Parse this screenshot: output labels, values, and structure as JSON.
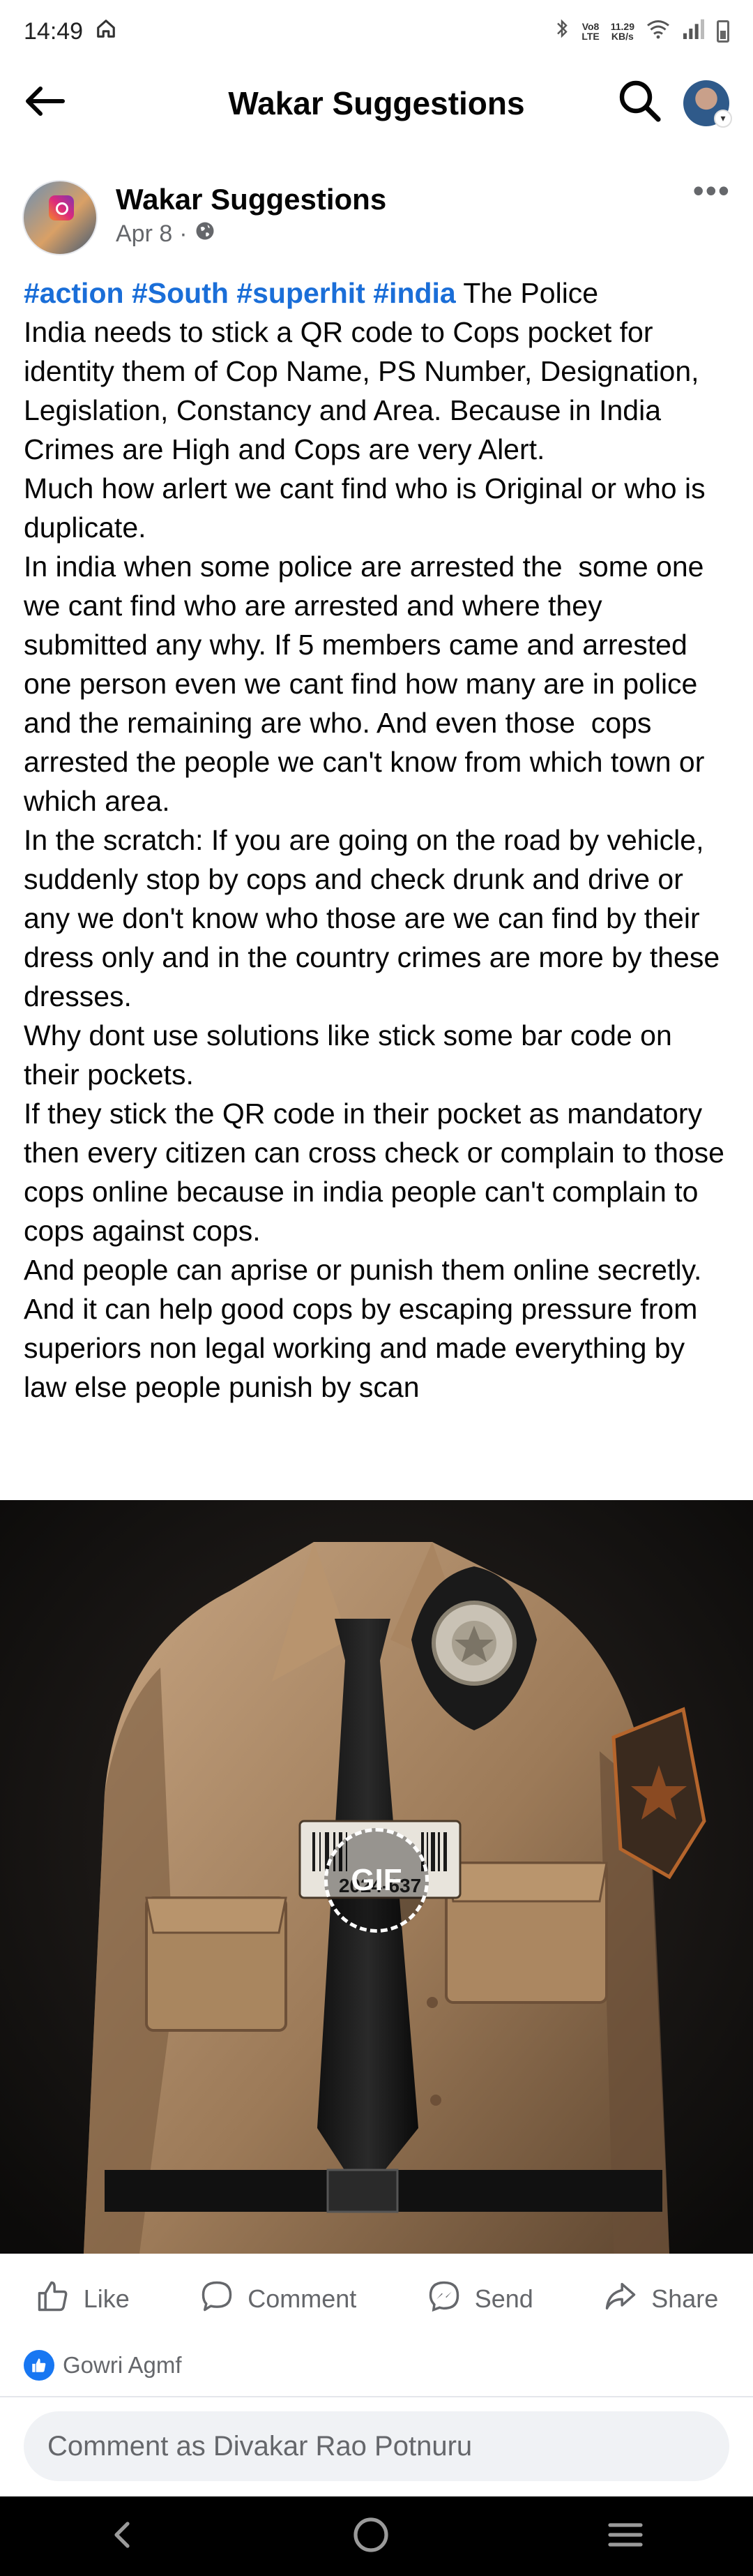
{
  "status_bar": {
    "time": "14:49",
    "network_volte": "Vo8",
    "network_lte": "LTE",
    "data_speed_value": "11.29",
    "data_speed_unit": "KB/s"
  },
  "header": {
    "title": "Wakar Suggestions"
  },
  "post": {
    "page_name": "Wakar Suggestions",
    "date": "Apr 8",
    "separator": "·",
    "hashtags": [
      "#action",
      "#South",
      "#superhit",
      "#india"
    ],
    "intro": "The Police",
    "paragraphs": [
      "India needs to stick a QR code to Cops pocket for identity them of Cop Name, PS Number, Designation, Legislation, Constancy and Area. Because in India Crimes are High and Cops are very Alert.",
      "Much how arlert we cant find who is Original or who is duplicate.",
      "In india when some police are arrested the  some one we cant find who are arrested and where they submitted any why. If 5 members came and arrested one person even we cant find how many are in police and the remaining are who. And even those  cops arrested the people we can't know from which town or which area.",
      "In the scratch: If you are going on the road by vehicle, suddenly stop by cops and check drunk and drive or any we don't know who those are we can find by their dress only and in the country crimes are more by these dresses.",
      "Why dont use solutions like stick some bar code on their pockets.",
      "If they stick the QR code in their pocket as mandatory then every citizen can cross check or complain to those cops online because in india people can't complain to cops against cops.",
      "And people can aprise or punish them online secretly.",
      "And it can help good cops by escaping pressure from superiors non legal working and made everything by law else people punish by scan"
    ],
    "image": {
      "gif_label": "GIF",
      "barcode_text": "2024-637"
    }
  },
  "actions": {
    "like": "Like",
    "comment": "Comment",
    "send": "Send",
    "share": "Share"
  },
  "reactions": {
    "names": "Gowri Agmf"
  },
  "comment_box": {
    "placeholder": "Comment as Divakar Rao Potnuru"
  },
  "colors": {
    "hashtag": "#1a6ed8",
    "like_blue": "#1877f2",
    "secondary_text": "#65676b",
    "comment_bg": "#f0f2f5"
  }
}
